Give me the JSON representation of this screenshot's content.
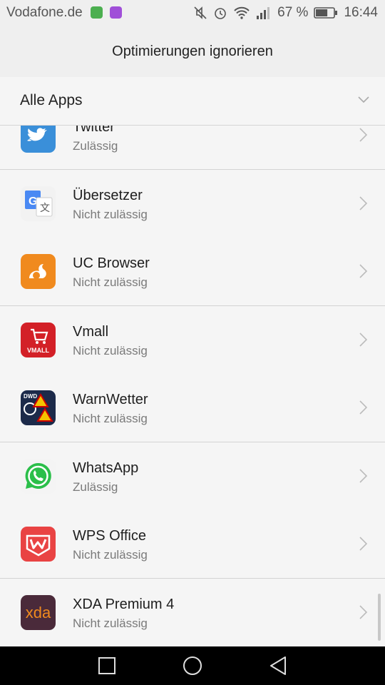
{
  "status_bar": {
    "carrier": "Vodafone.de",
    "battery_percent": "67 %",
    "battery_level": 0.67,
    "time": "16:44"
  },
  "header": {
    "title": "Optimierungen ignorieren"
  },
  "filter": {
    "label": "Alle Apps"
  },
  "apps": [
    {
      "name": "Twitter",
      "status": "Zulässig",
      "icon": "twitter-icon"
    },
    {
      "name": "Übersetzer",
      "status": "Nicht zulässig",
      "icon": "google-translate-icon"
    },
    {
      "name": "UC Browser",
      "status": "Nicht zulässig",
      "icon": "uc-browser-icon"
    },
    {
      "name": "Vmall",
      "status": "Nicht zulässig",
      "icon": "vmall-icon",
      "icon_text": "VMALL"
    },
    {
      "name": "WarnWetter",
      "status": "Nicht zulässig",
      "icon": "warnwetter-icon",
      "icon_text": "DWD"
    },
    {
      "name": "WhatsApp",
      "status": "Zulässig",
      "icon": "whatsapp-icon"
    },
    {
      "name": "WPS Office",
      "status": "Nicht zulässig",
      "icon": "wps-office-icon"
    },
    {
      "name": "XDA Premium 4",
      "status": "Nicht zulässig",
      "icon": "xda-icon",
      "icon_text": "xda"
    }
  ],
  "colors": {
    "twitter": "#3a8fd9",
    "uc_browser": "#f08a1e",
    "vmall": "#d32027",
    "warnwetter": "#1c2a4a",
    "whatsapp": "#2bbf4a",
    "wps": "#e94343",
    "xda": "#4a2a3a"
  }
}
